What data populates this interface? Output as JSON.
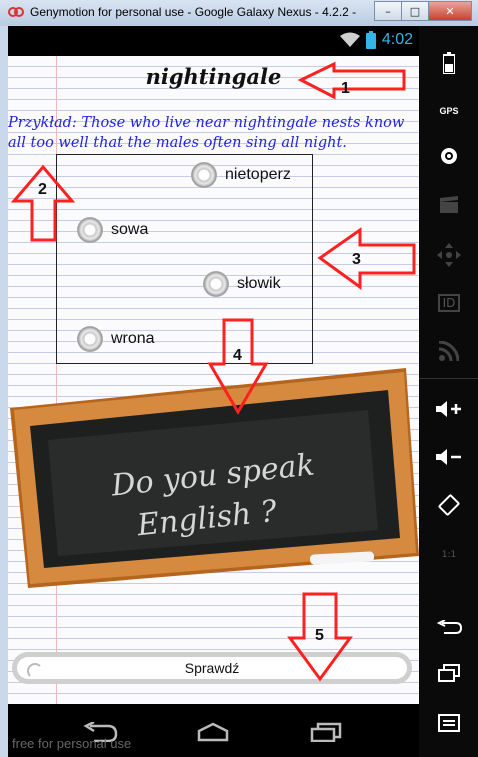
{
  "window": {
    "title": "Genymotion for personal use - Google Galaxy Nexus - 4.2.2 -",
    "minimize": "–",
    "maximize": "□",
    "close": "✕"
  },
  "status_bar": {
    "time": "4:02",
    "accent": "#33b5e5"
  },
  "exercise": {
    "word": "nightingale",
    "example": "Przykład: Those who live near nightingale nests know all too well that the males often sing all night.",
    "options": [
      "nietoperz",
      "sowa",
      "słowik",
      "wrona"
    ],
    "chalkboard": {
      "line1": "Do you speak",
      "line2": "English ?"
    },
    "check_button": "Sprawdź"
  },
  "annotations": [
    "1",
    "2",
    "3",
    "4",
    "5"
  ],
  "annotation_color": "#ff2020",
  "watermark": "free for personal use",
  "side_panel": {
    "buttons": [
      "battery-icon",
      "gps-icon",
      "camera-icon",
      "video-icon",
      "dpad-icon",
      "id-icon",
      "rss-icon",
      "volume-up-icon",
      "volume-down-icon",
      "rotate-icon",
      "scale-icon",
      "back-icon",
      "recent-apps-icon",
      "menu-icon"
    ],
    "gps_label": "GPS",
    "id_label": "ID",
    "scale_label": "1:1"
  }
}
